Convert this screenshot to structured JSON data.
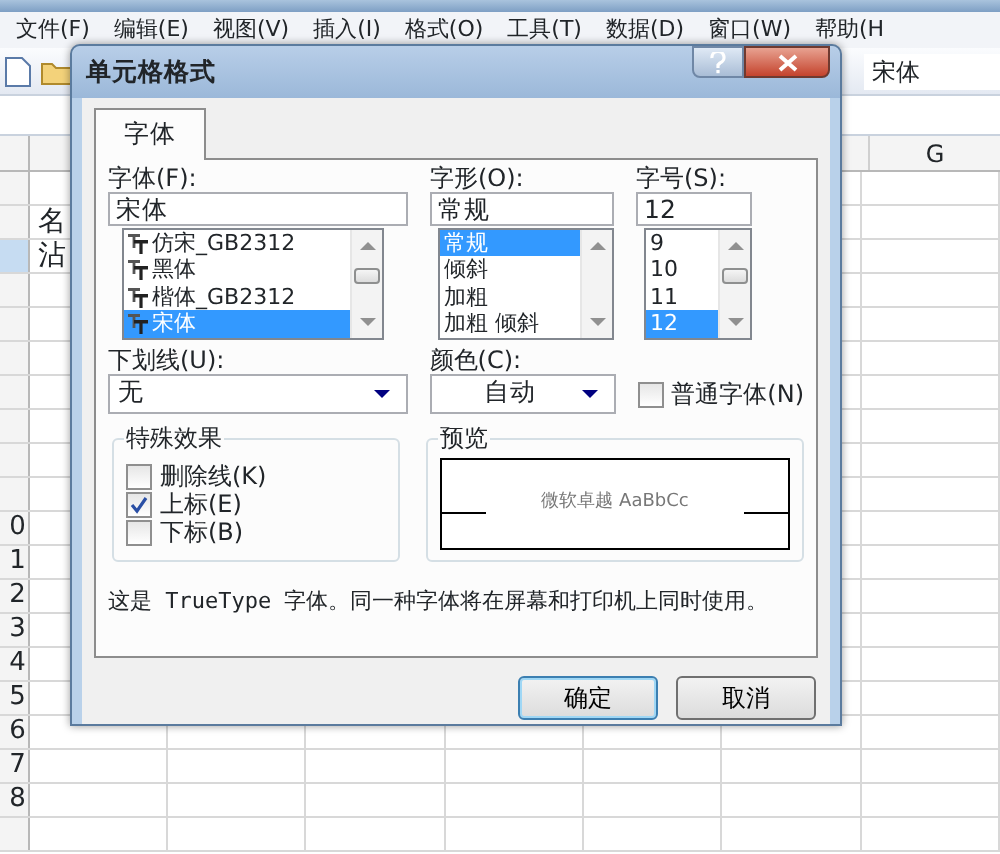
{
  "menu_bar": {
    "items": [
      "文件(F)",
      "编辑(E)",
      "视图(V)",
      "插入(I)",
      "格式(O)",
      "工具(T)",
      "数据(D)",
      "窗口(W)",
      "帮助(H"
    ]
  },
  "toolbar": {
    "font_name": "宋体"
  },
  "sheet": {
    "column_headers": [
      "G"
    ],
    "top_cells": [
      {
        "text": "名",
        "selected": false
      },
      {
        "text": "沾",
        "selected": true
      }
    ],
    "row_headers": [
      "0",
      "1",
      "2",
      "3",
      "4",
      "5",
      "6",
      "7",
      "8"
    ]
  },
  "dialog": {
    "title": "单元格格式",
    "tabs": [
      {
        "label": "字体",
        "selected": true
      }
    ],
    "font": {
      "label": "字体(F):",
      "value": "宋体",
      "options": [
        {
          "label": "仿宋_GB2312",
          "selected": false
        },
        {
          "label": "黑体",
          "selected": false
        },
        {
          "label": "楷体_GB2312",
          "selected": false
        },
        {
          "label": "宋体",
          "selected": true
        }
      ]
    },
    "style": {
      "label": "字形(O):",
      "value": "常规",
      "options": [
        {
          "label": "常规",
          "selected": true
        },
        {
          "label": "倾斜",
          "selected": false
        },
        {
          "label": "加粗",
          "selected": false
        },
        {
          "label": "加粗 倾斜",
          "selected": false
        }
      ]
    },
    "size": {
      "label": "字号(S):",
      "value": "12",
      "options": [
        {
          "label": "9",
          "selected": false
        },
        {
          "label": "10",
          "selected": false
        },
        {
          "label": "11",
          "selected": false
        },
        {
          "label": "12",
          "selected": true
        }
      ]
    },
    "underline": {
      "label": "下划线(U):",
      "value": "无"
    },
    "color": {
      "label": "颜色(C):",
      "value": "自动"
    },
    "normal_font": {
      "label": "普通字体(N)",
      "checked": false
    },
    "effects": {
      "title": "特殊效果",
      "items": [
        {
          "label": "删除线(K)",
          "checked": false
        },
        {
          "label": "上标(E)",
          "checked": true
        },
        {
          "label": "下标(B)",
          "checked": false
        }
      ]
    },
    "preview": {
      "title": "预览",
      "sample": "微软卓越  AaBbCc"
    },
    "description": "这是 TrueType 字体。同一种字体将在屏幕和打印机上同时使用。",
    "buttons": [
      {
        "label": "确定",
        "default": true
      },
      {
        "label": "取消",
        "default": false
      }
    ]
  }
}
